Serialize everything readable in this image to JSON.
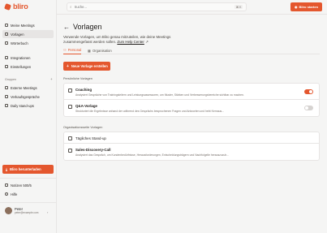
{
  "app": {
    "name": "bliro",
    "brand_color": "#e4572e"
  },
  "sidebar": {
    "items": [
      {
        "label": "Meine Meetings",
        "icon": "calendar-icon",
        "active": false
      },
      {
        "label": "Vorlagen",
        "icon": "template-icon",
        "active": true
      },
      {
        "label": "Wörterbuch",
        "icon": "book-icon",
        "active": false
      },
      {
        "label": "Integrationen",
        "icon": "plug-icon",
        "active": false
      },
      {
        "label": "Einstellungen",
        "icon": "gear-icon",
        "active": false
      }
    ],
    "groups_title": "Gruppen",
    "groups": [
      {
        "label": "Externe Meetings",
        "icon": "folder-icon"
      },
      {
        "label": "Verkaufsgespräche",
        "icon": "folder-icon"
      },
      {
        "label": "Daily stand-ups",
        "icon": "folder-icon"
      }
    ],
    "footer_button": "Bliro herunterladen",
    "footer_items": [
      {
        "label": "Notizen 500/5",
        "icon": "note-icon"
      },
      {
        "label": "Hilfe",
        "icon": "help-icon"
      }
    ],
    "user": {
      "name": "Peter",
      "email": "peter@example.com"
    }
  },
  "topbar": {
    "search_placeholder": "Suche...",
    "shortcut": "⌘ K",
    "start_button": "Bliro starten"
  },
  "main": {
    "title": "Vorlagen",
    "intro": "Verwende Vorlagen, um Bliro genau mitzuteilen, wie deine Meetings zusammengefasst werden sollen.",
    "help_link": "Zum Help Center",
    "tabs": [
      {
        "label": "Personal",
        "active": true
      },
      {
        "label": "Organisation",
        "active": false
      }
    ],
    "new_button": "Neue Vorlage erstellen",
    "personal_title": "Persönliche Vorlagen",
    "personal": [
      {
        "title": "Coaching",
        "desc": "Analysiert Gespräche von Trainingsleitern und Leistungsassessoren, um Muster, Stärken und Verbesserungsbereiche sichtbar zu machen.",
        "enabled": true
      },
      {
        "title": "Q&A-Vorlage",
        "desc": "Strukturiert die Ergebnisse anhand der während des Gesprächs besprochenen Fragen und Antworten und hebt Kernaus...",
        "enabled": false
      }
    ],
    "org_title": "Organisationsweite Vorlagen",
    "org": [
      {
        "title": "Tägliches Stand-up",
        "desc": ""
      },
      {
        "title": "Sales-Discovery-Call",
        "desc": "Analysiert das Gespräch, um Kundenbedürfnisse, Herausforderungen, Entscheidungsträgern und Nachfolgelle herauszuzuh..."
      }
    ]
  }
}
